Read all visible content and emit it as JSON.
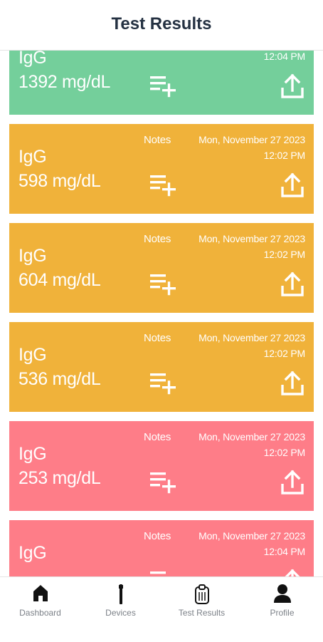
{
  "header": {
    "title": "Test Results"
  },
  "colors": {
    "normal": "#74cf9b",
    "moderate": "#f0b23a",
    "low": "#fe7d88",
    "tab_label": "#7c8188"
  },
  "results": [
    {
      "status": "normal",
      "notes_label": "",
      "date": "",
      "time": "12:04 PM",
      "test": "IgG",
      "value": "1392 mg/dL"
    },
    {
      "status": "moderate",
      "notes_label": "Notes",
      "date": "Mon, November 27 2023",
      "time": "12:02 PM",
      "test": "IgG",
      "value": "598 mg/dL"
    },
    {
      "status": "moderate",
      "notes_label": "Notes",
      "date": "Mon, November 27 2023",
      "time": "12:02 PM",
      "test": "IgG",
      "value": "604 mg/dL"
    },
    {
      "status": "moderate",
      "notes_label": "Notes",
      "date": "Mon, November 27 2023",
      "time": "12:02 PM",
      "test": "IgG",
      "value": "536 mg/dL"
    },
    {
      "status": "low",
      "notes_label": "Notes",
      "date": "Mon, November 27 2023",
      "time": "12:02 PM",
      "test": "IgG",
      "value": "253 mg/dL"
    },
    {
      "status": "low",
      "notes_label": "Notes",
      "date": "Mon, November 27 2023",
      "time": "12:04 PM",
      "test": "IgG",
      "value": ""
    }
  ],
  "card_icons": {
    "add_note": "playlist-add-icon",
    "share": "share-upload-icon"
  },
  "tabs": [
    {
      "label": "Dashboard",
      "icon": "home-icon"
    },
    {
      "label": "Devices",
      "icon": "device-icon"
    },
    {
      "label": "Test Results",
      "icon": "clipboard-icon"
    },
    {
      "label": "Profile",
      "icon": "person-icon"
    }
  ]
}
